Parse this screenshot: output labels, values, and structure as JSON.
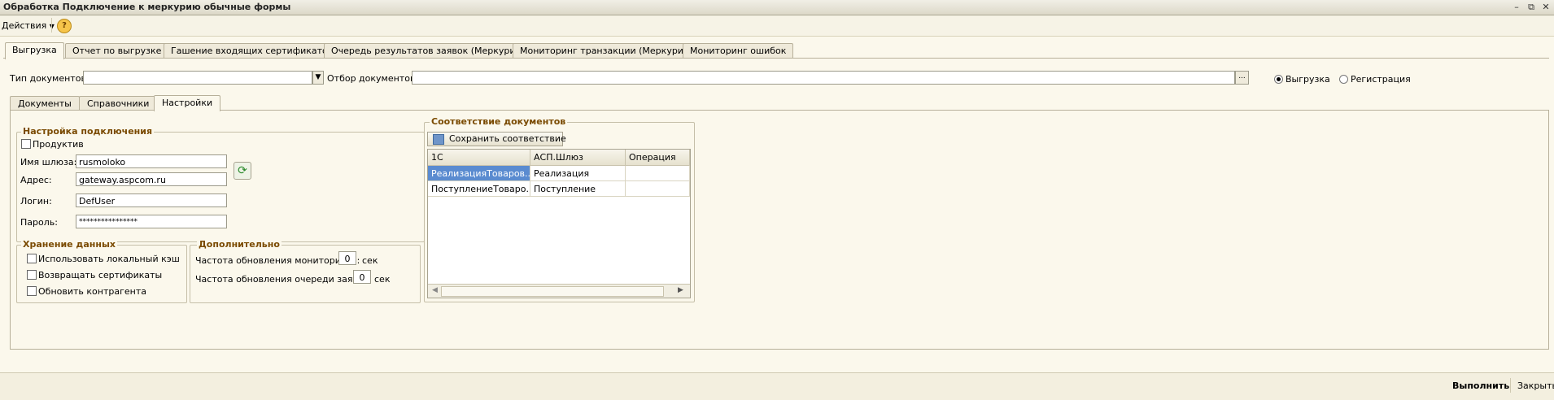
{
  "window": {
    "title": "Обработка  Подключение к меркурию обычные формы",
    "btn_min": "–",
    "btn_max": "⧉",
    "btn_close": "✕"
  },
  "toolbar": {
    "actions_label": "Действия",
    "help": "?"
  },
  "tabs": [
    "Выгрузка",
    "Отчет по выгрузке",
    "Гашение входящих сертификатов",
    "Очередь результатов заявок (Меркурий)",
    "Мониторинг транзакции (Меркурий)",
    "Мониторинг ошибок"
  ],
  "filters": {
    "doc_type_label": "Тип документов:",
    "doc_type_value": "",
    "doc_filter_label": "Отбор документов:",
    "doc_filter_value": "",
    "ellipsis": "...",
    "radio_export": "Выгрузка",
    "radio_register": "Регистрация",
    "selected": "Выгрузка"
  },
  "subtabs": [
    "Документы",
    "Справочники",
    "Настройки"
  ],
  "connection": {
    "title": "Настройка подключения",
    "productive_label": "Продуктив",
    "gateway_label": "Имя шлюза:",
    "gateway_value": "rusmoloko",
    "address_label": "Адрес:",
    "address_value": "gateway.aspcom.ru",
    "login_label": "Логин:",
    "login_value": "DefUser",
    "password_label": "Пароль:",
    "password_value": "****************"
  },
  "storage": {
    "title": "Хранение данных",
    "items": [
      "Использовать локальный кэш",
      "Возвращать сертификаты",
      "Обновить контрагента"
    ]
  },
  "extra": {
    "title": "Дополнительно",
    "monitor_label": "Частота обновления мониторинга:",
    "monitor_value": "0",
    "monitor_unit": "сек",
    "queue_label": "Частота обновления очереди заявок:",
    "queue_value": "0",
    "queue_unit": "сек"
  },
  "mapping": {
    "title": "Соответствие документов",
    "save_button": "Сохранить соответствие",
    "columns": [
      "1С",
      "АСП.Шлюз",
      "Операция"
    ],
    "rows": [
      [
        "РеализацияТоваров...",
        "Реализация",
        ""
      ],
      [
        "ПоступлениеТоваро...",
        "Поступление",
        ""
      ]
    ]
  },
  "footer": {
    "run": "Выполнить",
    "close": "Закрыть"
  }
}
